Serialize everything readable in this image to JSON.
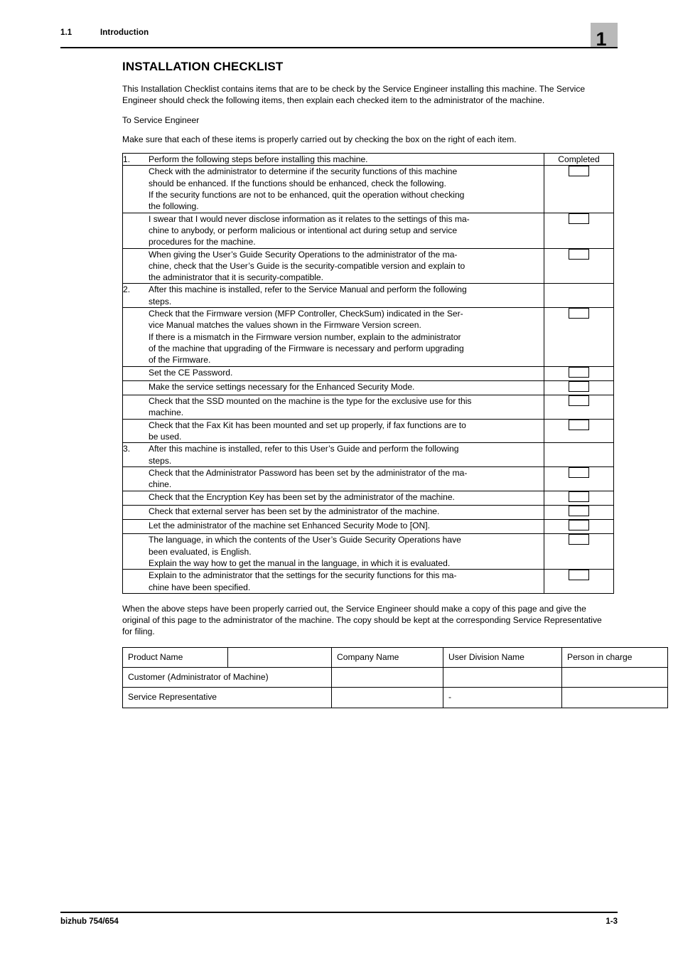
{
  "header": {
    "section_number": "1.1",
    "section_title": "Introduction",
    "chapter_badge": "1"
  },
  "main": {
    "title": "INSTALLATION CHECKLIST",
    "intro_paragraph": "This Installation Checklist contains items that are to be check by the Service Engineer installing this machine. The Service Engineer should check the following items, then explain each checked item to the administrator of the machine.",
    "addressee": "To Service Engineer",
    "instruction": "Make sure that each of these items is properly carried out by checking the box on the right of each item.",
    "closing_paragraph": "When the above steps have been properly carried out, the Service Engineer should make a copy of this page and give the original of this page to the administrator of the machine. The copy should be kept at the corresponding Service Representative for filing."
  },
  "checklist": {
    "completed_header": "Completed",
    "rows": [
      {
        "number": "1.",
        "text": "Perform the following steps before installing this machine.",
        "is_section": true,
        "checkbox": false
      },
      {
        "number": "",
        "line1": "Check with the administrator to determine if the security functions of this machine",
        "line2": "should be enhanced. If the functions should be enhanced, check the following.",
        "line3": "If the security functions are not to be enhanced, quit the operation without checking",
        "line4": "the following.",
        "is_section": false,
        "checkbox": true
      },
      {
        "number": "",
        "line1": "I swear that I would never disclose information as it relates to the settings of this ma-",
        "line2": "chine to anybody, or perform malicious or intentional act during setup and service",
        "line3": "procedures for the machine.",
        "is_section": false,
        "checkbox": true
      },
      {
        "number": "",
        "line1": "When giving the User’s Guide Security Operations to the administrator of the ma-",
        "line2": "chine, check that the User’s Guide is the security-compatible version and explain to",
        "line3": "the administrator that it is security-compatible.",
        "is_section": false,
        "checkbox": true
      },
      {
        "number": "2.",
        "line1": "After this machine is installed, refer to the Service Manual and perform the following",
        "line2": "steps.",
        "is_section": true,
        "checkbox": false
      },
      {
        "number": "",
        "line1": "Check that the Firmware version (MFP Controller, CheckSum) indicated in the Ser-",
        "line2": "vice Manual matches the values shown in the Firmware Version screen.",
        "line3": "If there is a mismatch in the Firmware version number, explain to the administrator",
        "line4": "of the machine that upgrading of the Firmware is necessary and perform upgrading",
        "line5": "of the Firmware.",
        "is_section": false,
        "checkbox": true
      },
      {
        "number": "",
        "line1": "Set the CE Password.",
        "is_section": false,
        "checkbox": true
      },
      {
        "number": "",
        "line1": "Make the service settings necessary for the Enhanced Security Mode.",
        "is_section": false,
        "checkbox": true
      },
      {
        "number": "",
        "line1": "Check that the SSD mounted on the machine is the type for the exclusive use for this",
        "line2": "machine.",
        "is_section": false,
        "checkbox": true
      },
      {
        "number": "",
        "line1": "Check that the Fax Kit has been mounted and set up properly, if fax functions are to",
        "line2": "be used.",
        "is_section": false,
        "checkbox": true
      },
      {
        "number": "3.",
        "line1": "After this machine is installed, refer to this User’s Guide and perform the following",
        "line2": "steps.",
        "is_section": true,
        "checkbox": false
      },
      {
        "number": "",
        "line1": "Check that the Administrator Password has been set by the administrator of the ma-",
        "line2": "chine.",
        "is_section": false,
        "checkbox": true
      },
      {
        "number": "",
        "line1": "Check that the Encryption Key has been set by the administrator of the machine.",
        "is_section": false,
        "checkbox": true
      },
      {
        "number": "",
        "line1": "Check that external server has been set by the administrator of the machine.",
        "is_section": false,
        "checkbox": true
      },
      {
        "number": "",
        "line1": "Let the administrator of the machine set Enhanced Security Mode to [ON].",
        "is_section": false,
        "checkbox": true
      },
      {
        "number": "",
        "line1": "The language, in which the contents of the User’s Guide Security Operations have",
        "line2": "been evaluated, is English.",
        "line3": "Explain the way how to get the manual in the language, in which it is evaluated.",
        "is_section": false,
        "checkbox": true
      },
      {
        "number": "",
        "line1": "Explain to the administrator that the settings for the security functions for this ma-",
        "line2": "chine have been specified.",
        "is_section": false,
        "checkbox": true
      }
    ]
  },
  "signature_table": {
    "row1": {
      "label": "Product Name",
      "value": "",
      "company_name": "Company Name",
      "user_division_name": "User Division Name",
      "person_in_charge": "Person in charge"
    },
    "row2": {
      "label": "Customer (Administrator of Machine)",
      "company_value": "",
      "division_value": "",
      "person_value": ""
    },
    "row3": {
      "label": "Service Representative",
      "company_value": "",
      "division_value": "-",
      "person_value": ""
    }
  },
  "footer": {
    "product": "bizhub 754/654",
    "page_number": "1-3"
  }
}
